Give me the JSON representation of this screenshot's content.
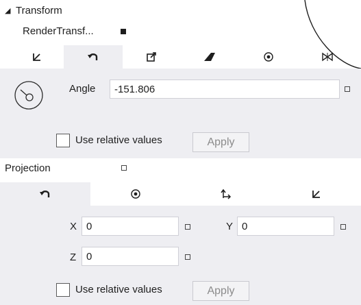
{
  "transform": {
    "title": "Transform",
    "render_transform_label": "RenderTransf...",
    "tabs": [
      {
        "icon": "translate-icon",
        "glyph": "↙",
        "selected": false
      },
      {
        "icon": "rotate-icon",
        "glyph": "↶",
        "selected": true
      },
      {
        "icon": "scale-icon",
        "glyph": "⧉",
        "selected": false
      },
      {
        "icon": "skew-icon",
        "glyph": "▰",
        "selected": false
      },
      {
        "icon": "center-point-icon",
        "glyph": "⊙",
        "selected": false
      },
      {
        "icon": "flip-icon",
        "glyph": "⋈",
        "selected": false
      }
    ],
    "angle_label": "Angle",
    "angle_value": "-151.806",
    "use_relative_label": "Use relative values",
    "apply_label": "Apply"
  },
  "projection": {
    "title": "Projection",
    "tabs": [
      {
        "icon": "rotate-icon",
        "glyph": "↶",
        "selected": true
      },
      {
        "icon": "center-point-icon",
        "glyph": "⊙",
        "selected": false
      },
      {
        "icon": "global-offset-icon",
        "glyph": "↳",
        "selected": false
      },
      {
        "icon": "local-offset-icon",
        "glyph": "↙",
        "selected": false
      }
    ],
    "x_label": "X",
    "x_value": "0",
    "y_label": "Y",
    "y_value": "0",
    "z_label": "Z",
    "z_value": "0",
    "use_relative_label": "Use relative values",
    "apply_label": "Apply"
  }
}
